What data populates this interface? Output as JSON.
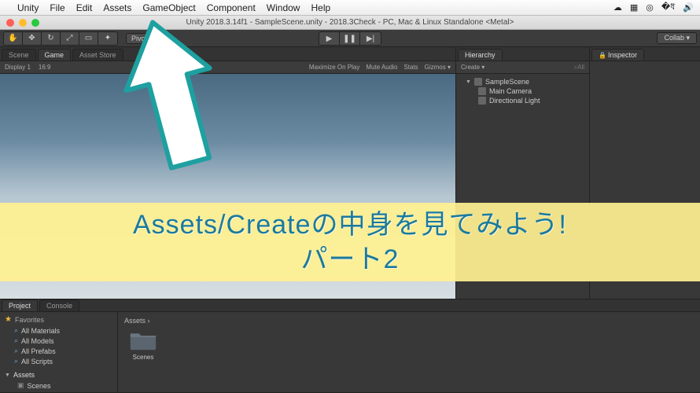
{
  "menubar": {
    "items": [
      "Unity",
      "File",
      "Edit",
      "Assets",
      "GameObject",
      "Component",
      "Window",
      "Help"
    ]
  },
  "titlebar": {
    "title": "Unity 2018.3.14f1 - SampleScene.unity - 2018.3Check - PC, Mac & Linux Standalone <Metal>"
  },
  "toolbar": {
    "pivot_label": "Pivot",
    "collab_label": "Collab ▾"
  },
  "scene_tabs": {
    "scene": "Scene",
    "game": "Game",
    "asset_store": "Asset Store"
  },
  "game_sub": {
    "display": "Display 1",
    "aspect": "16:9",
    "right": [
      "Maximize On Play",
      "Mute Audio",
      "Stats",
      "Gizmos ▾"
    ]
  },
  "hierarchy": {
    "title": "Hierarchy",
    "create": "Create ▾",
    "search_ph": "All",
    "scene": "SampleScene",
    "items": [
      "Main Camera",
      "Directional Light"
    ]
  },
  "inspector": {
    "title": "Inspector"
  },
  "project": {
    "tab_project": "Project",
    "tab_console": "Console",
    "favorites": "Favorites",
    "fav_items": [
      "All Materials",
      "All Models",
      "All Prefabs",
      "All Scripts"
    ],
    "assets": "Assets",
    "scenes_sub": "Scenes",
    "breadcrumb": "Assets ›",
    "folder_name": "Scenes"
  },
  "overlay": {
    "line1": "Assets/Createの中身を見てみよう!",
    "line2": "パート2"
  }
}
